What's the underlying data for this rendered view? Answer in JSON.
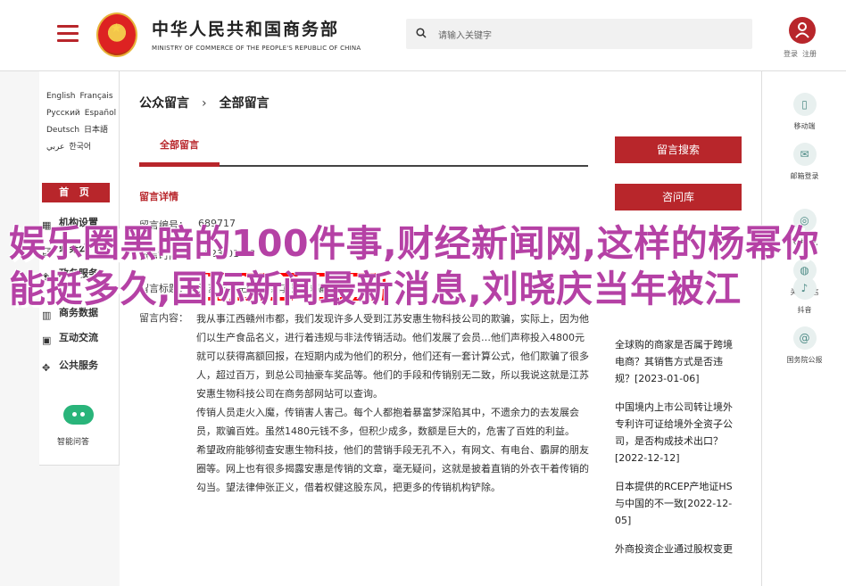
{
  "header": {
    "ministry_cn": "中华人民共和国商务部",
    "ministry_en": "MINISTRY OF COMMERCE OF THE PEOPLE'S REPUBLIC OF CHINA",
    "search_placeholder": "请输入关键字",
    "login": "登录",
    "register": "注册"
  },
  "left_nav": {
    "langs": [
      "English",
      "Français",
      "Русский",
      "Español",
      "Deutsch",
      "日本語",
      "عربي",
      "한국어"
    ],
    "home": "首 页",
    "items": [
      "机构设置",
      "政务公开",
      "政务服务",
      "商务数据",
      "互动交流",
      "公共服务"
    ],
    "wechat_label": "智能问答"
  },
  "main": {
    "breadcrumb": [
      "公众留言",
      "全部留言"
    ],
    "tab_active": "全部留言",
    "detail_title": "留言详情",
    "labels": {
      "number_label": "留言编号：",
      "number_value": "689717",
      "time_label": "留言时间：",
      "time_value": "2023-01-18",
      "title_label": "留言标题：",
      "title_value": "江苏安惠生物科技有限公司骗局",
      "content_label": "留言内容："
    },
    "content_paragraphs": [
      "我从事江西赣州市都，我们发现许多人受到江苏安惠生物科技公司的欺骗，实际上，因为他们以生产食品名义，进行着违规与非法传销活动。他们发展了会员…他们声称投入4800元就可以获得高额回报，在短期内成为他们的积分，他们还有一套计算公式，他们欺骗了很多人，超过百万，到总公司抽豪车奖品等。他们的手段和传销别无二致，所以我说这就是江苏安惠生物科技公司在商务部网站可以查询。",
      "传销人员走火入魔，传销害人害己。每个人都抱着暴富梦深陷其中，不遗余力的去发展会员，欺骗百姓。虽然1480元钱不多，但积少成多，数额是巨大的，危害了百姓的利益。",
      "希望政府能够彻查安惠生物科技，他们的营销手段无孔不入，有网文、有电台、霸屏的朋友圈等。网上也有很多揭露安惠是传销的文章，毫无疑问，这就是披着直销的外衣干着传销的勾当。望法律伸张正义，借着权健这股东风，把更多的传销机构铲除。"
    ],
    "right_buttons": [
      "留言搜索",
      "咨问库"
    ],
    "right_list": [
      "全球购的商家是否属于跨境电商？其销售方式是否违规？[2023-01-06]",
      "中国境内上市公司转让境外专利许可证给境外全资子公司，是否构成技术出口？[2022-12-12]",
      "日本提供的RCEP产地证HS与中国的不一致[2022-12-05]",
      "外商投资企业通过股权变更"
    ]
  },
  "right_rail": [
    {
      "icon": "mobile-icon",
      "label": "移动端"
    },
    {
      "icon": "mail-icon",
      "label": "邮箱登录"
    },
    {
      "icon": "weibo-icon",
      "label": "关注微博"
    },
    {
      "icon": "wechat-icon",
      "label": "关注微信"
    },
    {
      "icon": "douyin-icon",
      "label": "抖音"
    },
    {
      "icon": "at-icon",
      "label": "国务院公报"
    }
  ],
  "overlay": {
    "text": "娱乐圈黑暗的100件事,财经新闻网,这样的杨幂你能挺多久,国际新闻最新消息,刘晓庆当年被江"
  },
  "colors": {
    "accent": "#b8262b",
    "overlay": "#b541a5",
    "highlight": "#ff0000"
  }
}
